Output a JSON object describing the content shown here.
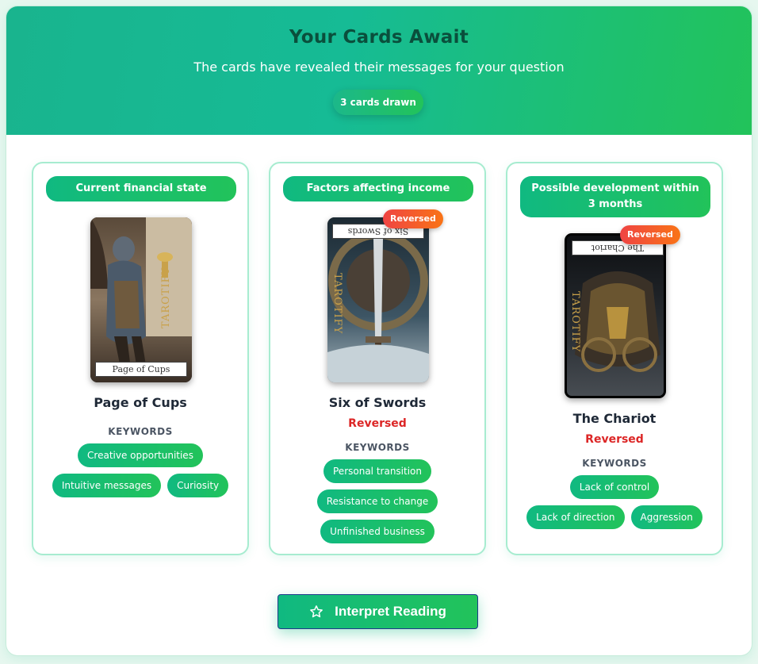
{
  "header": {
    "title": "Your Cards Await",
    "subtitle": "The cards have revealed their messages for your question",
    "count_label": "3 cards drawn"
  },
  "keywords_heading": "KEYWORDS",
  "cards": [
    {
      "position": "Current financial state",
      "name": "Page of Cups",
      "nameplate": "Page of Cups",
      "brand": "TAROTIFY",
      "reversed": false,
      "keywords": [
        "Creative opportunities",
        "Intuitive messages",
        "Curiosity"
      ]
    },
    {
      "position": "Factors affecting income",
      "name": "Six of Swords",
      "nameplate": "Six of Swords",
      "brand": "TAROTIFY",
      "reversed": true,
      "badge": "Reversed",
      "status": "Reversed",
      "keywords": [
        "Personal transition",
        "Resistance to change",
        "Unfinished business"
      ]
    },
    {
      "position": "Possible development within 3 months",
      "name": "The Chariot",
      "nameplate": "The Chariot",
      "brand": "TAROTIFY",
      "reversed": true,
      "badge": "Reversed",
      "status": "Reversed",
      "keywords": [
        "Lack of control",
        "Lack of direction",
        "Aggression"
      ]
    }
  ],
  "action": {
    "label": "Interpret Reading",
    "icon": "star-outline-icon"
  },
  "colors": {
    "accent_start": "#10b981",
    "accent_end": "#22c35a",
    "reversed": "#dc2626"
  }
}
